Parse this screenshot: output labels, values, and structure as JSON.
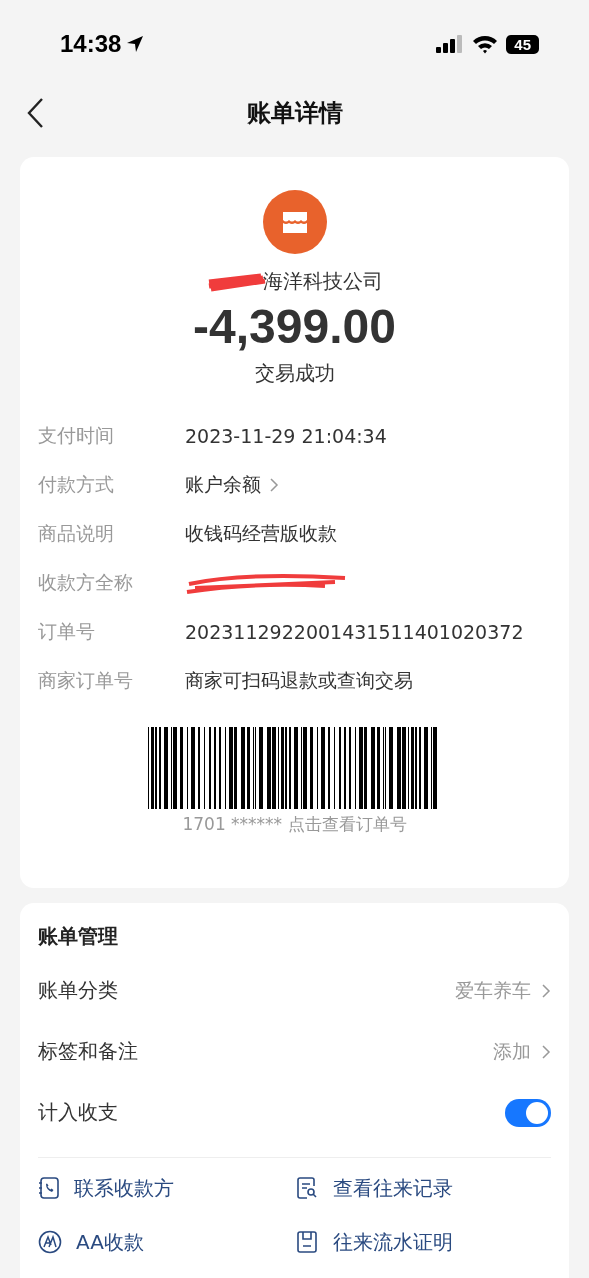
{
  "status_bar": {
    "time": "14:38",
    "battery": "45"
  },
  "nav": {
    "title": "账单详情"
  },
  "summary": {
    "merchant": "海洋科技公司",
    "merchant_redacted": true,
    "amount": "-4,399.00",
    "status": "交易成功"
  },
  "details": [
    {
      "label": "支付时间",
      "value": "2023-11-29 21:04:34",
      "kind": "text"
    },
    {
      "label": "付款方式",
      "value": "账户余额",
      "kind": "link"
    },
    {
      "label": "商品说明",
      "value": "收钱码经营版收款",
      "kind": "text"
    },
    {
      "label": "收款方全称",
      "kind": "redacted"
    },
    {
      "label": "订单号",
      "value": "2023112922001431511401020372",
      "kind": "text"
    },
    {
      "label": "商家订单号",
      "value": "商家可扫码退款或查询交易",
      "kind": "text"
    }
  ],
  "barcode": {
    "caption": "1701 ****** 点击查看订单号"
  },
  "management": {
    "title": "账单管理",
    "rows": [
      {
        "label": "账单分类",
        "value": "爱车养车",
        "kind": "link"
      },
      {
        "label": "标签和备注",
        "value": "添加",
        "kind": "link"
      },
      {
        "label": "计入收支",
        "kind": "toggle",
        "on": true
      }
    ]
  },
  "actions": [
    {
      "label": "联系收款方",
      "kind": "phone"
    },
    {
      "label": "查看往来记录",
      "kind": "record"
    },
    {
      "label": "AA收款",
      "kind": "split"
    },
    {
      "label": "往来流水证明",
      "kind": "proof"
    }
  ]
}
